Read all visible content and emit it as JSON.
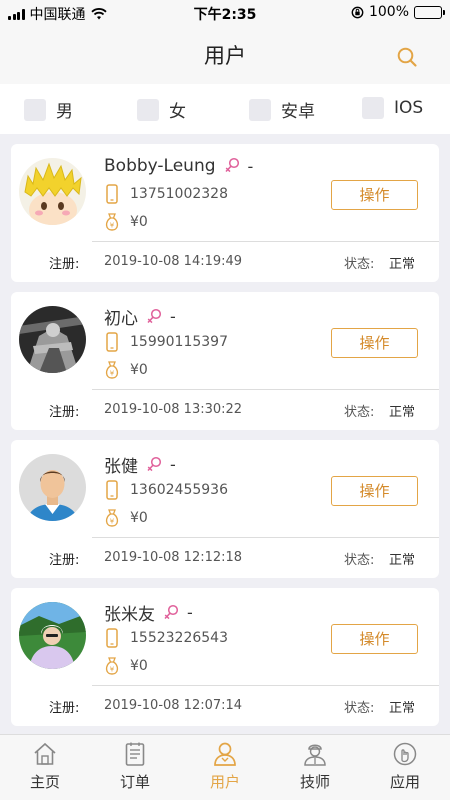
{
  "status_bar": {
    "carrier": "中国联通",
    "time": "下午2:35",
    "battery": "100%"
  },
  "header": {
    "title": "用户"
  },
  "filters": [
    {
      "label": "男"
    },
    {
      "label": "女"
    },
    {
      "label": "安卓"
    },
    {
      "label": "IOS"
    }
  ],
  "users": [
    {
      "name": "Bobby-Leung",
      "gender": "-",
      "phone": "13751002328",
      "balance": "¥0",
      "action": "操作",
      "reg_label": "注册:",
      "reg_time": "2019-10-08 14:19:49",
      "status_label": "状态:",
      "status": "正常"
    },
    {
      "name": "初心",
      "gender": "-",
      "phone": "15990115397",
      "balance": "¥0",
      "action": "操作",
      "reg_label": "注册:",
      "reg_time": "2019-10-08 13:30:22",
      "status_label": "状态:",
      "status": "正常"
    },
    {
      "name": "张健",
      "gender": "-",
      "phone": "13602455936",
      "balance": "¥0",
      "action": "操作",
      "reg_label": "注册:",
      "reg_time": "2019-10-08 12:12:18",
      "status_label": "状态:",
      "status": "正常"
    },
    {
      "name": "张米友",
      "gender": "-",
      "phone": "15523226543",
      "balance": "¥0",
      "action": "操作",
      "reg_label": "注册:",
      "reg_time": "2019-10-08 12:07:14",
      "status_label": "状态:",
      "status": "正常"
    }
  ],
  "tabs": [
    {
      "label": "主页",
      "icon": "home-icon"
    },
    {
      "label": "订单",
      "icon": "orders-icon"
    },
    {
      "label": "用户",
      "icon": "user-icon"
    },
    {
      "label": "技师",
      "icon": "technician-icon"
    },
    {
      "label": "应用",
      "icon": "apps-icon"
    }
  ],
  "active_tab": "用户",
  "colors": {
    "accent": "#e3a546",
    "gender_icon": "#e0609a",
    "background": "#efeff4"
  }
}
